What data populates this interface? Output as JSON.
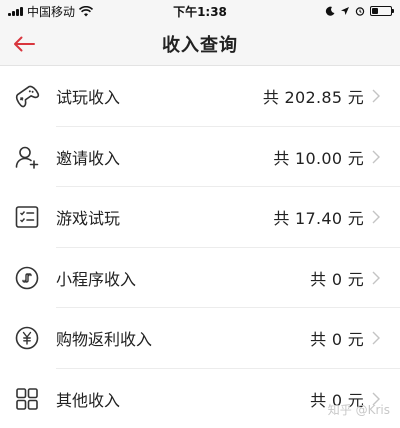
{
  "status_bar": {
    "carrier": "中国移动",
    "time": "下午1:38"
  },
  "nav": {
    "title": "收入查询"
  },
  "rows": [
    {
      "icon": "gamepad-icon",
      "label": "试玩收入",
      "amount": "共 202.85 元"
    },
    {
      "icon": "add-user-icon",
      "label": "邀请收入",
      "amount": "共 10.00 元"
    },
    {
      "icon": "checklist-icon",
      "label": "游戏试玩",
      "amount": "共 17.40 元"
    },
    {
      "icon": "mini-program-icon",
      "label": "小程序收入",
      "amount": "共 0 元"
    },
    {
      "icon": "yen-coin-icon",
      "label": "购物返利收入",
      "amount": "共 0 元"
    },
    {
      "icon": "grid-icon",
      "label": "其他收入",
      "amount": "共 0 元"
    }
  ],
  "watermark": "知乎 @Kris",
  "colors": {
    "back_arrow": "#d9363e",
    "background": "#f6f6f6"
  }
}
